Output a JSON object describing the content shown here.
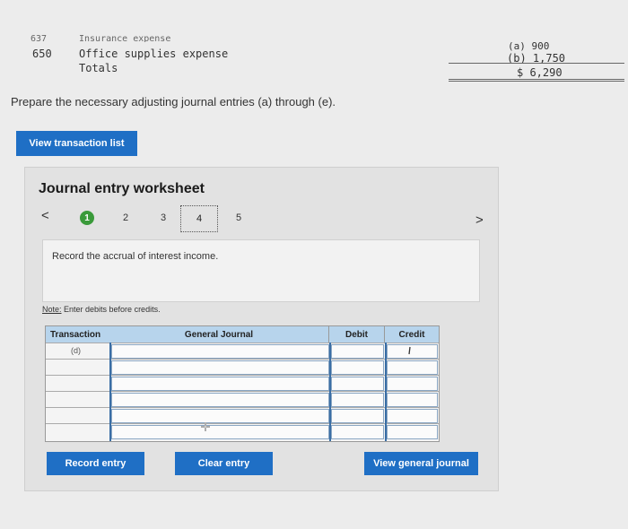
{
  "ledger": {
    "rows": [
      {
        "code": "637",
        "name": "Insurance expense",
        "value": "(a) 900"
      },
      {
        "code": "650",
        "name": "Office supplies expense",
        "value": "(b) 1,750"
      },
      {
        "code": "",
        "name": "Totals",
        "value": "$ 6,290"
      }
    ]
  },
  "prompt": "Prepare the necessary adjusting journal entries (a) through (e).",
  "view_transaction_list": "View transaction list",
  "worksheet": {
    "title": "Journal entry worksheet",
    "pages": [
      "1",
      "2",
      "3",
      "4",
      "5"
    ],
    "active_page": "1",
    "task": "Record the accrual of interest income.",
    "note_label": "Note:",
    "note_text": " Enter debits before credits.",
    "columns": {
      "transaction": "Transaction",
      "general_journal": "General Journal",
      "debit": "Debit",
      "credit": "Credit"
    },
    "rows": [
      "(d)",
      "",
      "",
      "",
      "",
      ""
    ]
  },
  "buttons": {
    "record": "Record entry",
    "clear": "Clear entry",
    "view_general_journal": "View general journal"
  }
}
